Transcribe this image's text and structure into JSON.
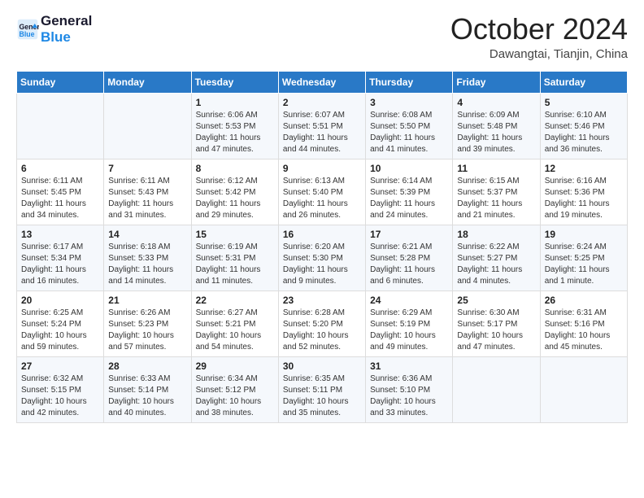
{
  "logo": {
    "line1": "General",
    "line2": "Blue"
  },
  "title": "October 2024",
  "location": "Dawangtai, Tianjin, China",
  "days_of_week": [
    "Sunday",
    "Monday",
    "Tuesday",
    "Wednesday",
    "Thursday",
    "Friday",
    "Saturday"
  ],
  "weeks": [
    [
      {
        "day": "",
        "sunrise": "",
        "sunset": "",
        "daylight": ""
      },
      {
        "day": "",
        "sunrise": "",
        "sunset": "",
        "daylight": ""
      },
      {
        "day": "1",
        "sunrise": "Sunrise: 6:06 AM",
        "sunset": "Sunset: 5:53 PM",
        "daylight": "Daylight: 11 hours and 47 minutes."
      },
      {
        "day": "2",
        "sunrise": "Sunrise: 6:07 AM",
        "sunset": "Sunset: 5:51 PM",
        "daylight": "Daylight: 11 hours and 44 minutes."
      },
      {
        "day": "3",
        "sunrise": "Sunrise: 6:08 AM",
        "sunset": "Sunset: 5:50 PM",
        "daylight": "Daylight: 11 hours and 41 minutes."
      },
      {
        "day": "4",
        "sunrise": "Sunrise: 6:09 AM",
        "sunset": "Sunset: 5:48 PM",
        "daylight": "Daylight: 11 hours and 39 minutes."
      },
      {
        "day": "5",
        "sunrise": "Sunrise: 6:10 AM",
        "sunset": "Sunset: 5:46 PM",
        "daylight": "Daylight: 11 hours and 36 minutes."
      }
    ],
    [
      {
        "day": "6",
        "sunrise": "Sunrise: 6:11 AM",
        "sunset": "Sunset: 5:45 PM",
        "daylight": "Daylight: 11 hours and 34 minutes."
      },
      {
        "day": "7",
        "sunrise": "Sunrise: 6:11 AM",
        "sunset": "Sunset: 5:43 PM",
        "daylight": "Daylight: 11 hours and 31 minutes."
      },
      {
        "day": "8",
        "sunrise": "Sunrise: 6:12 AM",
        "sunset": "Sunset: 5:42 PM",
        "daylight": "Daylight: 11 hours and 29 minutes."
      },
      {
        "day": "9",
        "sunrise": "Sunrise: 6:13 AM",
        "sunset": "Sunset: 5:40 PM",
        "daylight": "Daylight: 11 hours and 26 minutes."
      },
      {
        "day": "10",
        "sunrise": "Sunrise: 6:14 AM",
        "sunset": "Sunset: 5:39 PM",
        "daylight": "Daylight: 11 hours and 24 minutes."
      },
      {
        "day": "11",
        "sunrise": "Sunrise: 6:15 AM",
        "sunset": "Sunset: 5:37 PM",
        "daylight": "Daylight: 11 hours and 21 minutes."
      },
      {
        "day": "12",
        "sunrise": "Sunrise: 6:16 AM",
        "sunset": "Sunset: 5:36 PM",
        "daylight": "Daylight: 11 hours and 19 minutes."
      }
    ],
    [
      {
        "day": "13",
        "sunrise": "Sunrise: 6:17 AM",
        "sunset": "Sunset: 5:34 PM",
        "daylight": "Daylight: 11 hours and 16 minutes."
      },
      {
        "day": "14",
        "sunrise": "Sunrise: 6:18 AM",
        "sunset": "Sunset: 5:33 PM",
        "daylight": "Daylight: 11 hours and 14 minutes."
      },
      {
        "day": "15",
        "sunrise": "Sunrise: 6:19 AM",
        "sunset": "Sunset: 5:31 PM",
        "daylight": "Daylight: 11 hours and 11 minutes."
      },
      {
        "day": "16",
        "sunrise": "Sunrise: 6:20 AM",
        "sunset": "Sunset: 5:30 PM",
        "daylight": "Daylight: 11 hours and 9 minutes."
      },
      {
        "day": "17",
        "sunrise": "Sunrise: 6:21 AM",
        "sunset": "Sunset: 5:28 PM",
        "daylight": "Daylight: 11 hours and 6 minutes."
      },
      {
        "day": "18",
        "sunrise": "Sunrise: 6:22 AM",
        "sunset": "Sunset: 5:27 PM",
        "daylight": "Daylight: 11 hours and 4 minutes."
      },
      {
        "day": "19",
        "sunrise": "Sunrise: 6:24 AM",
        "sunset": "Sunset: 5:25 PM",
        "daylight": "Daylight: 11 hours and 1 minute."
      }
    ],
    [
      {
        "day": "20",
        "sunrise": "Sunrise: 6:25 AM",
        "sunset": "Sunset: 5:24 PM",
        "daylight": "Daylight: 10 hours and 59 minutes."
      },
      {
        "day": "21",
        "sunrise": "Sunrise: 6:26 AM",
        "sunset": "Sunset: 5:23 PM",
        "daylight": "Daylight: 10 hours and 57 minutes."
      },
      {
        "day": "22",
        "sunrise": "Sunrise: 6:27 AM",
        "sunset": "Sunset: 5:21 PM",
        "daylight": "Daylight: 10 hours and 54 minutes."
      },
      {
        "day": "23",
        "sunrise": "Sunrise: 6:28 AM",
        "sunset": "Sunset: 5:20 PM",
        "daylight": "Daylight: 10 hours and 52 minutes."
      },
      {
        "day": "24",
        "sunrise": "Sunrise: 6:29 AM",
        "sunset": "Sunset: 5:19 PM",
        "daylight": "Daylight: 10 hours and 49 minutes."
      },
      {
        "day": "25",
        "sunrise": "Sunrise: 6:30 AM",
        "sunset": "Sunset: 5:17 PM",
        "daylight": "Daylight: 10 hours and 47 minutes."
      },
      {
        "day": "26",
        "sunrise": "Sunrise: 6:31 AM",
        "sunset": "Sunset: 5:16 PM",
        "daylight": "Daylight: 10 hours and 45 minutes."
      }
    ],
    [
      {
        "day": "27",
        "sunrise": "Sunrise: 6:32 AM",
        "sunset": "Sunset: 5:15 PM",
        "daylight": "Daylight: 10 hours and 42 minutes."
      },
      {
        "day": "28",
        "sunrise": "Sunrise: 6:33 AM",
        "sunset": "Sunset: 5:14 PM",
        "daylight": "Daylight: 10 hours and 40 minutes."
      },
      {
        "day": "29",
        "sunrise": "Sunrise: 6:34 AM",
        "sunset": "Sunset: 5:12 PM",
        "daylight": "Daylight: 10 hours and 38 minutes."
      },
      {
        "day": "30",
        "sunrise": "Sunrise: 6:35 AM",
        "sunset": "Sunset: 5:11 PM",
        "daylight": "Daylight: 10 hours and 35 minutes."
      },
      {
        "day": "31",
        "sunrise": "Sunrise: 6:36 AM",
        "sunset": "Sunset: 5:10 PM",
        "daylight": "Daylight: 10 hours and 33 minutes."
      },
      {
        "day": "",
        "sunrise": "",
        "sunset": "",
        "daylight": ""
      },
      {
        "day": "",
        "sunrise": "",
        "sunset": "",
        "daylight": ""
      }
    ]
  ]
}
